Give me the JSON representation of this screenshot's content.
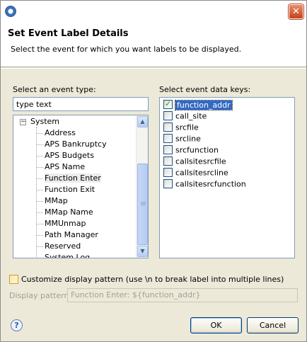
{
  "window": {
    "close_glyph": "✕"
  },
  "header": {
    "title": "Set Event Label Details",
    "description": "Select the event for which you want labels to be displayed."
  },
  "event_type": {
    "label": "Select an event type:",
    "filter_value": "type text",
    "tree": {
      "root": {
        "label": "System",
        "expanded": true
      },
      "items": [
        {
          "label": "Address",
          "selected": false
        },
        {
          "label": "APS Bankruptcy",
          "selected": false
        },
        {
          "label": "APS Budgets",
          "selected": false
        },
        {
          "label": "APS Name",
          "selected": false
        },
        {
          "label": "Function Enter",
          "selected": true
        },
        {
          "label": "Function Exit",
          "selected": false
        },
        {
          "label": "MMap",
          "selected": false
        },
        {
          "label": "MMap Name",
          "selected": false
        },
        {
          "label": "MMUnmap",
          "selected": false
        },
        {
          "label": "Path Manager",
          "selected": false
        },
        {
          "label": "Reserved",
          "selected": false
        },
        {
          "label": "System Log",
          "selected": false
        }
      ]
    }
  },
  "data_keys": {
    "label": "Select event data keys:",
    "items": [
      {
        "label": "function_addr",
        "checked": true,
        "selected": true
      },
      {
        "label": "call_site",
        "checked": false,
        "selected": false
      },
      {
        "label": "srcfile",
        "checked": false,
        "selected": false
      },
      {
        "label": "srcline",
        "checked": false,
        "selected": false
      },
      {
        "label": "srcfunction",
        "checked": false,
        "selected": false
      },
      {
        "label": "callsitesrcfile",
        "checked": false,
        "selected": false
      },
      {
        "label": "callsitesrcline",
        "checked": false,
        "selected": false
      },
      {
        "label": "callsitesrcfunction",
        "checked": false,
        "selected": false
      }
    ]
  },
  "customize": {
    "label": "Customize display pattern (use \\n to break label into multiple lines)",
    "checked": false
  },
  "display_pattern": {
    "label": "Display pattern:",
    "value": "Function Enter: ${function_addr}"
  },
  "buttons": {
    "help_glyph": "?",
    "ok": "OK",
    "cancel": "Cancel"
  }
}
